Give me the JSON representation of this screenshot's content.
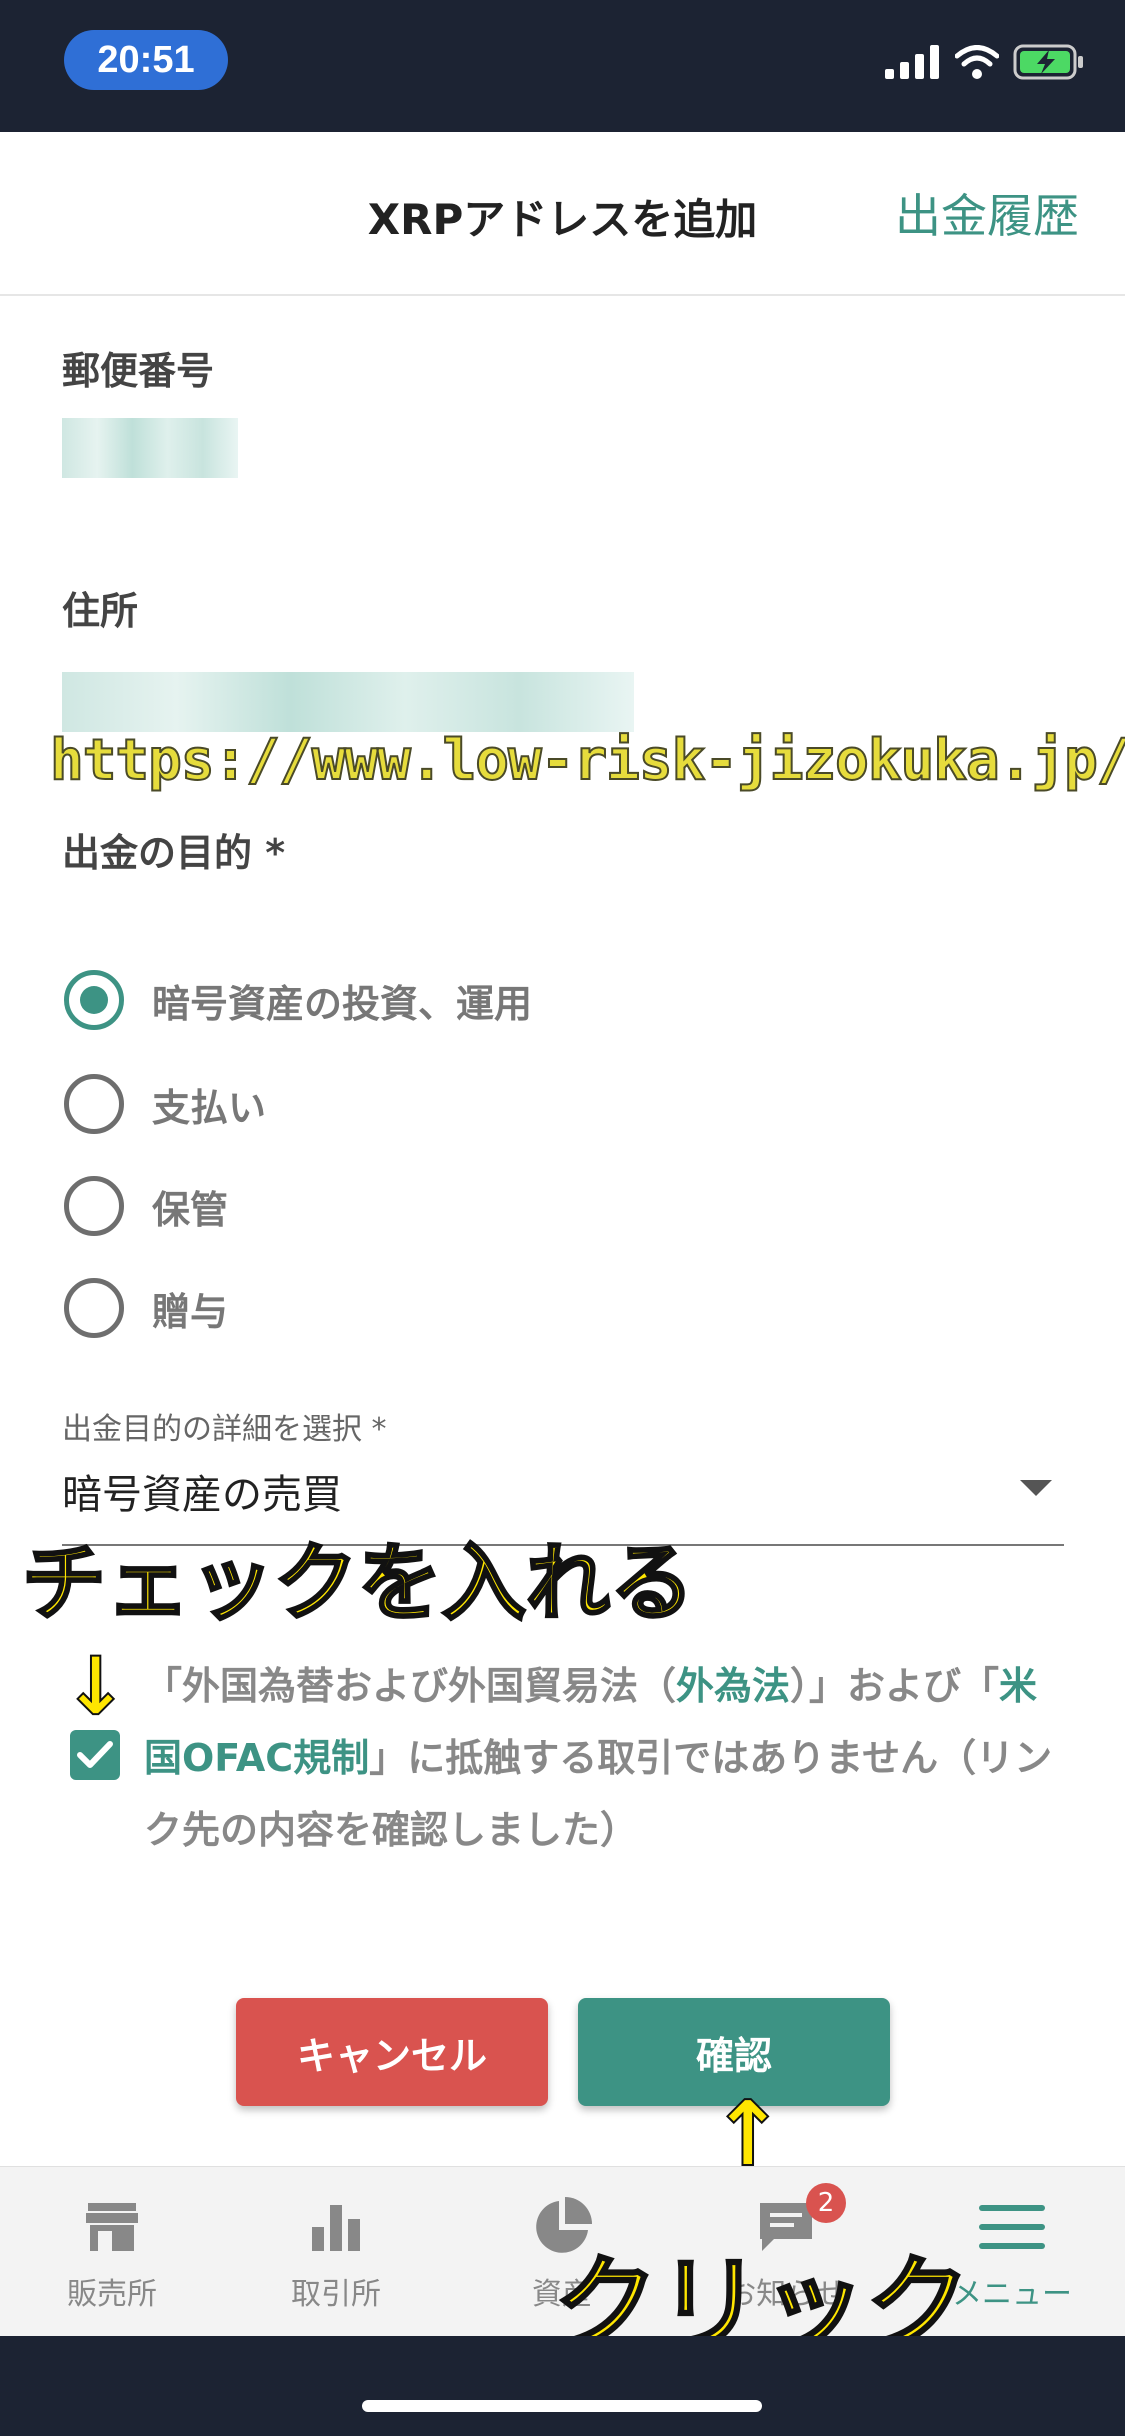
{
  "status": {
    "time": "20:51"
  },
  "header": {
    "title": "XRPアドレスを追加",
    "history_link": "出金履歴"
  },
  "form": {
    "postal_label": "郵便番号",
    "address_label": "住所",
    "purpose_label": "出金の目的 *",
    "purpose_options": [
      {
        "label": "暗号資産の投資、運用",
        "selected": true
      },
      {
        "label": "支払い",
        "selected": false
      },
      {
        "label": "保管",
        "selected": false
      },
      {
        "label": "贈与",
        "selected": false
      }
    ],
    "detail_select_label": "出金目的の詳細を選択 *",
    "detail_select_value": "暗号資産の売買"
  },
  "agreement": {
    "checked": true,
    "text_part1": "「外国為替および外国貿易法（",
    "link1": "外為法",
    "text_part2": "）」および「",
    "link2": "米国OFAC規制",
    "text_part3": "」に抵触する取引ではありません（リンク先の内容を確認しました）"
  },
  "buttons": {
    "cancel": "キャンセル",
    "confirm": "確認"
  },
  "tabbar": {
    "items": [
      {
        "label": "販売所",
        "icon": "store-icon"
      },
      {
        "label": "取引所",
        "icon": "bar-chart-icon"
      },
      {
        "label": "資産",
        "icon": "pie-chart-icon"
      },
      {
        "label": "お知らせ",
        "icon": "chat-icon",
        "badge": "2"
      },
      {
        "label": "メニュー",
        "icon": "menu-icon",
        "active": true
      }
    ]
  },
  "overlay": {
    "watermark": "https://www.low-risk-jizokuka.jp/",
    "check_note": "チェックを入れる",
    "click_note": "クリック",
    "arrow_down": "↓",
    "arrow_up": "↑"
  },
  "colors": {
    "accent": "#3d9384",
    "danger": "#d9534f",
    "status_bar": "#1c2333"
  }
}
